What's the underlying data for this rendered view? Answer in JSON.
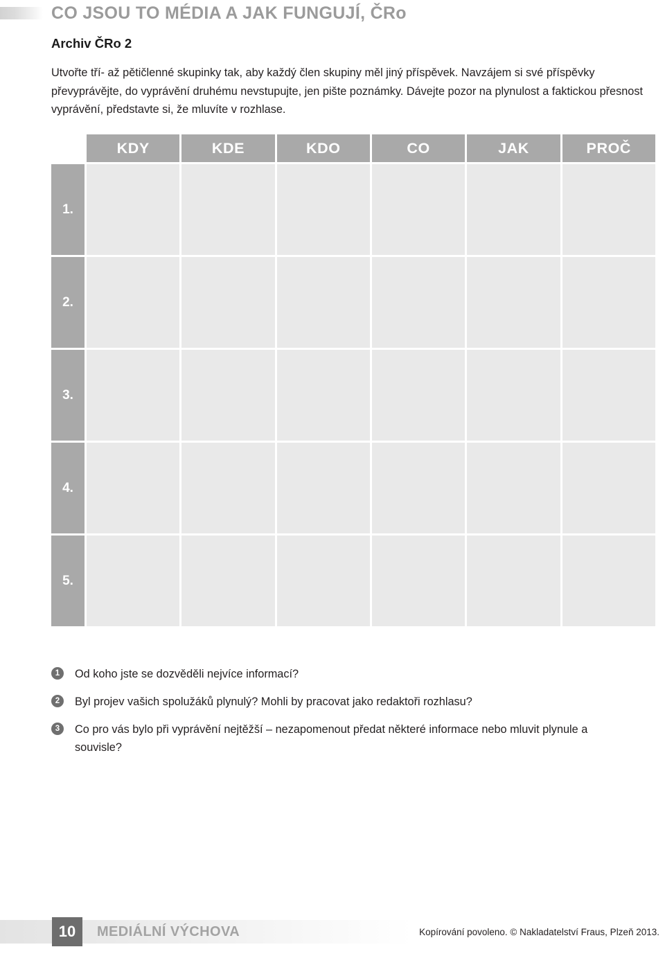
{
  "header": {
    "title": "CO JSOU TO MÉDIA A JAK FUNGUJÍ, ČRo",
    "accent_color": "#9b9b9b"
  },
  "content": {
    "subtitle": "Archiv ČRo 2",
    "intro": "Utvořte tří- až pětičlenné skupinky tak, aby každý člen skupiny měl jiný příspěvek. Navzájem si své příspěvky převyprávějte, do vyprávění druhému nevstupujte, jen pište poznámky. Dávejte pozor na plynulost a faktickou přesnost vyprávění, představte si, že mluvíte v rozhlase."
  },
  "worksheet_table": {
    "header_bg": "#a9a9a9",
    "cell_bg": "#e9e9e9",
    "columns": [
      "KDY",
      "KDE",
      "KDO",
      "CO",
      "JAK",
      "PROČ"
    ],
    "row_labels": [
      "1.",
      "2.",
      "3.",
      "4.",
      "5."
    ],
    "cell_values": [
      [
        "",
        "",
        "",
        "",
        "",
        ""
      ],
      [
        "",
        "",
        "",
        "",
        "",
        ""
      ],
      [
        "",
        "",
        "",
        "",
        "",
        ""
      ],
      [
        "",
        "",
        "",
        "",
        "",
        ""
      ],
      [
        "",
        "",
        "",
        "",
        "",
        ""
      ]
    ]
  },
  "questions": [
    {
      "number": "1",
      "text": "Od koho jste se dozvěděli nejvíce informací?"
    },
    {
      "number": "2",
      "text": "Byl projev vašich spolužáků plynulý? Mohli by pracovat jako redaktoři rozhlasu?"
    },
    {
      "number": "3",
      "text": "Co pro vás bylo při vyprávění nejtěžší – nezapomenout předat některé informace nebo mluvit plynule a souvisle?"
    }
  ],
  "footer": {
    "page_number": "10",
    "section": "MEDIÁLNÍ VÝCHOVA",
    "copyright": "Kopírování povoleno. © Nakladatelství Fraus, Plzeň 2013."
  }
}
